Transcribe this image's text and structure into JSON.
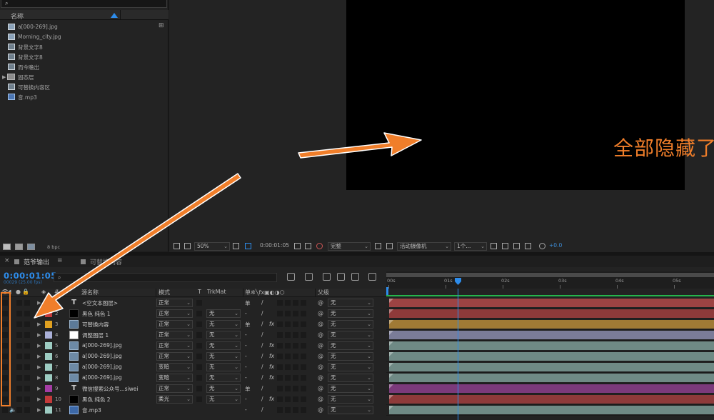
{
  "project": {
    "column_name": "名称",
    "items": [
      {
        "name": "a[000-269].jpg",
        "type": "image"
      },
      {
        "name": "Morning_city.jpg",
        "type": "image"
      },
      {
        "name": "背景文字8",
        "type": "comp"
      },
      {
        "name": "背景文字8",
        "type": "comp"
      },
      {
        "name": "而今瞻出",
        "type": "comp"
      },
      {
        "name": "固态层",
        "type": "folder"
      },
      {
        "name": "可替换内容区",
        "type": "comp"
      },
      {
        "name": "音.mp3",
        "type": "audio"
      }
    ],
    "bpc": "8 bpc"
  },
  "viewer": {
    "annotation": "全部隐藏了",
    "toolbar": {
      "zoom": "50%",
      "time": "0:00:01:05",
      "resolution": "完整",
      "camera": "活动摄像机",
      "views": "1个...",
      "exposure": "+0.0"
    }
  },
  "timeline": {
    "tabs": [
      {
        "label": "范爷输出",
        "active": true
      },
      {
        "label": "可替换内容",
        "active": false
      }
    ],
    "current_time": "0:00:01:05",
    "fps_info": "00029 (25.00 fps)",
    "ruler": [
      "00s",
      "01s",
      "02s",
      "03s",
      "04s",
      "05s"
    ],
    "headers": {
      "source_name": "源名称",
      "mode": "模式",
      "t": "T",
      "trkmat": "TrkMat",
      "parent": "父级"
    },
    "layers": [
      {
        "num": "1",
        "name": "<空文本图层>",
        "mode": "正常",
        "trkmat": "",
        "parent": "无",
        "label_color": "#d24a3a",
        "bar_color": "#9d4343",
        "thumb": "text",
        "sw1": "单",
        "sw2": "/",
        "fx": ""
      },
      {
        "num": "2",
        "name": "黑色 纯色 1",
        "mode": "正常",
        "trkmat": "无",
        "parent": "无",
        "label_color": "#c33a3a",
        "bar_color": "#8e3a3a",
        "thumb": "black",
        "sw1": "-",
        "sw2": "/",
        "fx": ""
      },
      {
        "num": "3",
        "name": "可替换内容",
        "mode": "正常",
        "trkmat": "无",
        "parent": "无",
        "label_color": "#e0a020",
        "bar_color": "#a07a35",
        "thumb": "img",
        "sw1": "单",
        "sw2": "/",
        "fx": "fx"
      },
      {
        "num": "4",
        "name": "调整图层 1",
        "mode": "正常",
        "trkmat": "无",
        "parent": "无",
        "label_color": "#aab0d8",
        "bar_color": "#7a7c98",
        "thumb": "white",
        "sw1": "-",
        "sw2": "/",
        "fx": ""
      },
      {
        "num": "5",
        "name": "a[000-269].jpg",
        "mode": "正常",
        "trkmat": "无",
        "parent": "无",
        "label_color": "#9dccc2",
        "bar_color": "#6f8a85",
        "thumb": "img2",
        "sw1": "-",
        "sw2": "/",
        "fx": "fx"
      },
      {
        "num": "6",
        "name": "a[000-269].jpg",
        "mode": "正常",
        "trkmat": "无",
        "parent": "无",
        "label_color": "#9dccc2",
        "bar_color": "#6f8a85",
        "thumb": "img2",
        "sw1": "-",
        "sw2": "/",
        "fx": "fx"
      },
      {
        "num": "7",
        "name": "a[000-269].jpg",
        "mode": "变暗",
        "trkmat": "无",
        "parent": "无",
        "label_color": "#9dccc2",
        "bar_color": "#6f8a85",
        "thumb": "img2",
        "sw1": "-",
        "sw2": "/",
        "fx": "fx"
      },
      {
        "num": "8",
        "name": "a[000-269].jpg",
        "mode": "变暗",
        "trkmat": "无",
        "parent": "无",
        "label_color": "#9dccc2",
        "bar_color": "#6f8a85",
        "thumb": "img2",
        "sw1": "-",
        "sw2": "/",
        "fx": "fx"
      },
      {
        "num": "9",
        "name": "微信搜索公众号...siwei",
        "mode": "正常",
        "trkmat": "无",
        "parent": "无",
        "label_color": "#a43da4",
        "bar_color": "#7b3a7b",
        "thumb": "text",
        "sw1": "单",
        "sw2": "/",
        "fx": ""
      },
      {
        "num": "10",
        "name": "黑色 纯色 2",
        "mode": "柔光",
        "trkmat": "无",
        "parent": "无",
        "label_color": "#c33a3a",
        "bar_color": "#8e3a3a",
        "thumb": "black",
        "sw1": "-",
        "sw2": "/",
        "fx": "fx"
      },
      {
        "num": "11",
        "name": "音.mp3",
        "mode": "",
        "trkmat": "",
        "parent": "无",
        "label_color": "#9dccc2",
        "bar_color": "#6f8a85",
        "thumb": "audio",
        "sw1": "-",
        "sw2": "/",
        "fx": ""
      }
    ]
  },
  "colors": {
    "accent_blue": "#2d8ceb",
    "annotation_orange": "#f07e2a",
    "workarea_green": "#26b54c"
  }
}
